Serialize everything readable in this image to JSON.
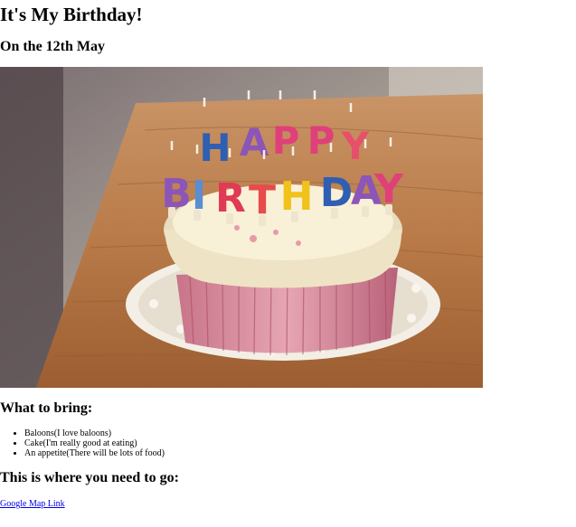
{
  "page": {
    "title": "It's My Birthday!",
    "subtitle": "On the 12th May"
  },
  "photo": {
    "alt": "Birthday cake with candles",
    "candles_top": [
      "H",
      "A",
      "P",
      "P",
      "Y"
    ],
    "candles_bottom": [
      "B",
      "I",
      "R",
      "T",
      "H",
      "D",
      "A",
      "Y"
    ]
  },
  "bring": {
    "heading": "What to bring:",
    "items": [
      "Baloons(I love baloons)",
      "Cake(I'm really good at eating)",
      "An appetite(There will be lots of food)"
    ]
  },
  "directions": {
    "heading": "This is where you need to go:",
    "link_label": "Google Map Link"
  },
  "colors": {
    "link": "#0000ee",
    "wood": "#b97a48",
    "frosting": "#f1e8cf",
    "wrapper": "#d98ea0"
  }
}
